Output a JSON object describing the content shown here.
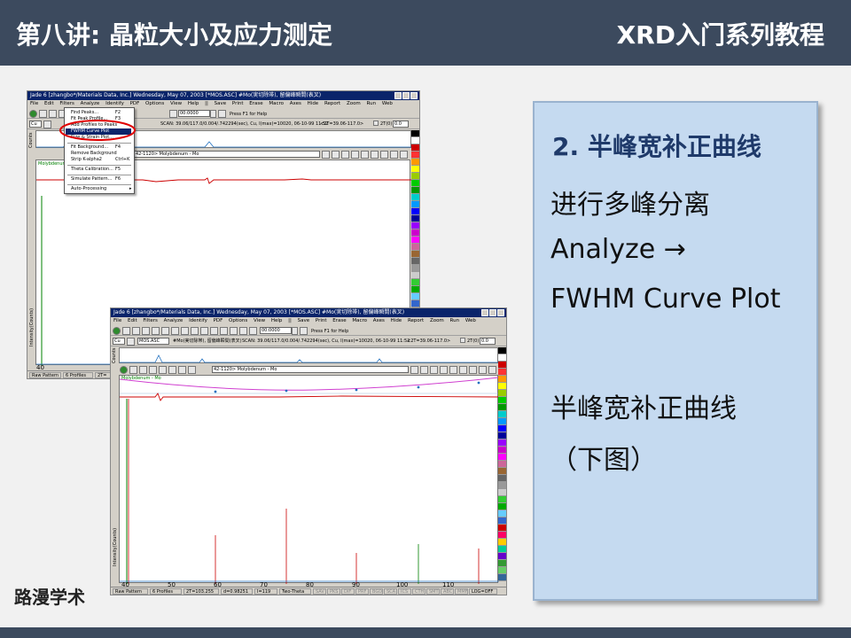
{
  "slide": {
    "title_left": "第八讲: 晶粒大小及应力测定",
    "title_right": "XRD入门系列教程",
    "brand": "路漫学术"
  },
  "panel": {
    "title": "2. 半峰宽补正曲线",
    "lines": [
      "进行多峰分离",
      "Analyze →",
      "FWHM Curve Plot",
      "半峰宽补正曲线",
      "（下图）"
    ]
  },
  "win1": {
    "titlebar": "Jade 6 [zhangbo*/Materials Data, Inc.] Wednesday, May 07, 2003 [*MOS.ASC] #Mo(実切除帯), 留偏峰瞬間(表叉)",
    "menus": [
      "File",
      "Edit",
      "Filters",
      "Analyze",
      "Identify",
      "PDF",
      "Options",
      "View",
      "Help",
      "||",
      "Save",
      "Print",
      "Erase",
      "Macro",
      "Axes",
      "Hide",
      "Report",
      "Zoom",
      "Run",
      "Web"
    ],
    "field": "00:0000",
    "help": "Press F1 for Help",
    "scan": "SCAN: 39.06/117.0/0.004/.742294(sec), Cu, I(max)=10020, 06-10-99 11:52",
    "range": "<2T=39.06-117.0>",
    "theta": "2T(0)",
    "theta_val": "0.0",
    "pdf_card": "42-1120> Molybdenum - Mo",
    "legend": "Molybdenum - M",
    "counts": "Counts",
    "ylabel": "Intensity(Counts)",
    "xtick": "40",
    "status": [
      "Raw Pattern",
      "6 Profiles",
      "2T="
    ]
  },
  "menu": {
    "items": [
      {
        "label": "Find Peaks...",
        "shortcut": "F2"
      },
      {
        "label": "Fit Peak Profile...",
        "shortcut": "F3"
      },
      {
        "label": "Add Profiles to Peaks",
        "shortcut": ""
      },
      {
        "label": "FWHM Curve Plot",
        "shortcut": ""
      },
      {
        "label": "Size & Strain Plot...",
        "shortcut": ""
      },
      {
        "label": "Fit Background...",
        "shortcut": "F4"
      },
      {
        "label": "Remove Background",
        "shortcut": ""
      },
      {
        "label": "Strip K-alpha2",
        "shortcut": "Ctrl+K"
      },
      {
        "label": "Theta Calibration...",
        "shortcut": "F5"
      },
      {
        "label": "Simulate Pattern...",
        "shortcut": "F6"
      },
      {
        "label": "Auto-Processing",
        "shortcut": "▸"
      }
    ],
    "selected_index": 3
  },
  "win2": {
    "titlebar": "Jade 6 [zhangbo*/Materials Data, Inc.] Wednesday, May 07, 2003 [*MOS.ASC] #Mo(実切除帯), 留偏峰瞬間(表叉)",
    "menus": [
      "File",
      "Edit",
      "Filters",
      "Analyze",
      "Identify",
      "PDF",
      "Options",
      "View",
      "Help",
      "||",
      "Save",
      "Print",
      "Erase",
      "Macro",
      "Axes",
      "Hide",
      "Report",
      "Zoom",
      "Run",
      "Web"
    ],
    "field": "00:0000",
    "help": "Press F1 for Help",
    "file": "MOS.ASC",
    "sample": "#Mo(実切除帯), 留偏峰瞬間(表叉)",
    "scan": "SCAN: 39.06/117.0/0.004/.742294(sec), Cu, I(max)=10020, 06-10-99 11:52",
    "range": "<2T=39.06-117.0>",
    "theta": "2T(0)",
    "theta_val": "0.0",
    "pdf_card": "42-1120> Molybdenum - Mo",
    "legend": "Molybdenum - Mo",
    "counts": "Counts",
    "ylabel": "Intensity(Counts)",
    "xticks": [
      "40",
      "50",
      "60",
      "70",
      "80",
      "90",
      "100",
      "110"
    ],
    "status": [
      "Raw Pattern",
      "6 Profiles",
      "2T=103.255",
      "d=0.98251",
      "I=119",
      "Two-Theta",
      "SAV",
      "PKS",
      "DIF",
      "PRF",
      "BGD",
      "SCA",
      "ICS",
      "CTH",
      "SMT",
      "ABC",
      "MMF",
      "LOG=OFF"
    ]
  },
  "colors": {
    "header_bg": "#3c4a5e",
    "panel_bg": "#c5daf0",
    "panel_title": "#1f3a6a",
    "win_title": "#0a246a",
    "pattern_red": "#cc0000",
    "fwhm_magenta": "#d040d0",
    "stick_green": "#008000"
  }
}
